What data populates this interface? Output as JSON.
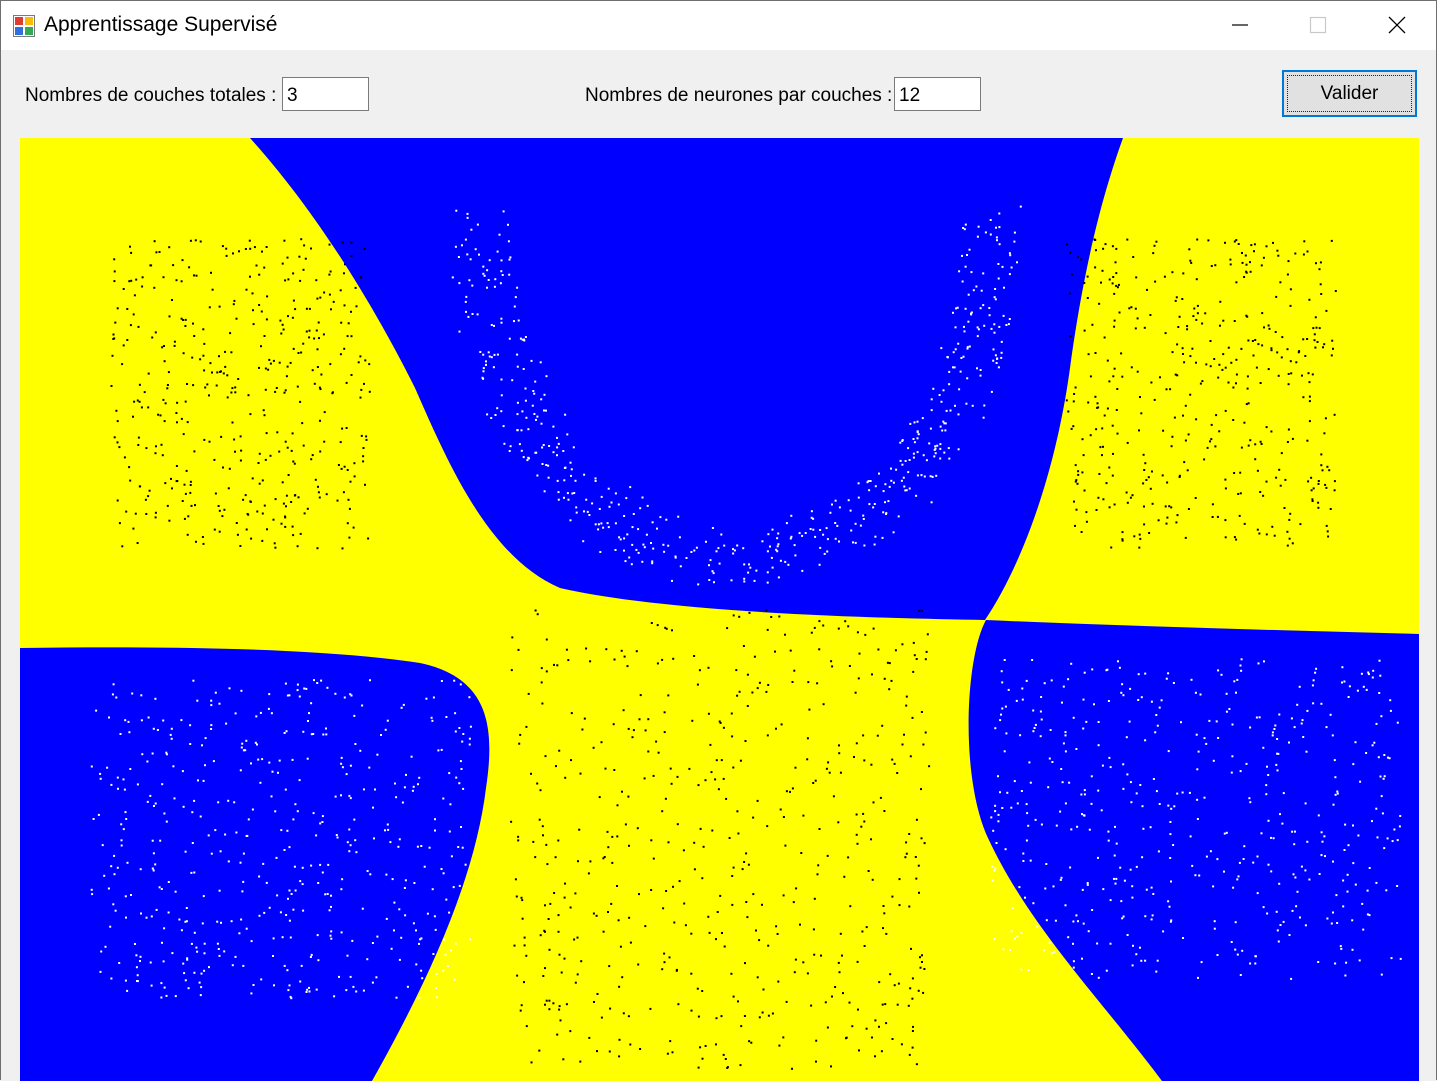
{
  "window": {
    "title": "Apprentissage Supervisé",
    "icons": {
      "app": "windows-forms-app-icon",
      "minimize": "minimize-icon",
      "maximize": "maximize-icon",
      "close": "close-icon"
    }
  },
  "form": {
    "layers_label": "Nombres de couches totales :",
    "layers_value": "3",
    "neurons_label": "Nombres de neurones par couches :",
    "neurons_value": "12",
    "submit_label": "Valider"
  },
  "plot": {
    "class_colors": {
      "region_a": "#0000ff",
      "region_b": "#ffff00",
      "points_on_a": "#ffffff",
      "points_on_b": "#000000"
    }
  }
}
